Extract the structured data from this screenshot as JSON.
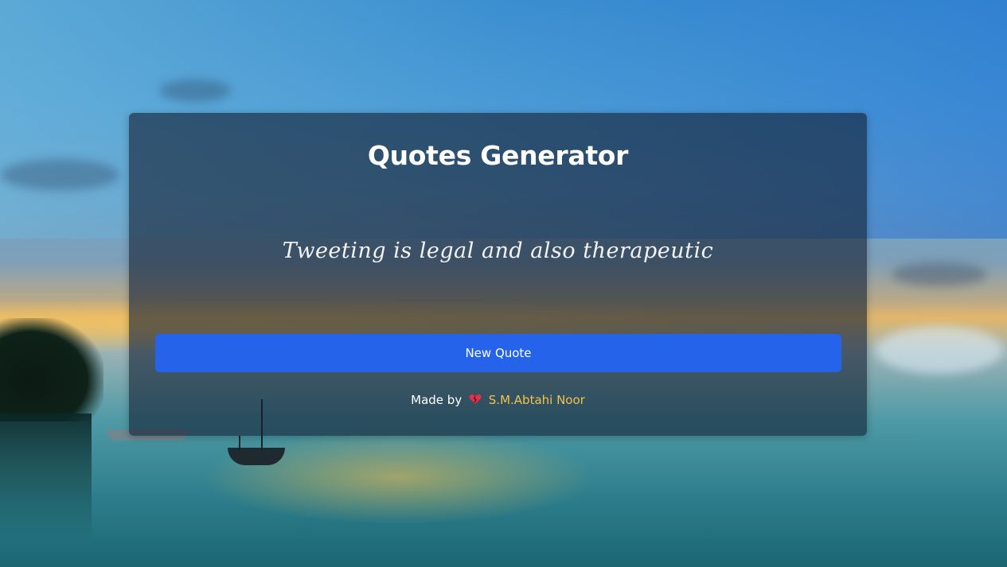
{
  "app": {
    "title": "Quotes Generator"
  },
  "quote": {
    "text": "Tweeting is legal and also therapeutic"
  },
  "actions": {
    "new_quote_label": "New Quote"
  },
  "footer": {
    "made_by_label": "Made by",
    "heart_icon": "broken-heart-icon",
    "author_name": "S.M.Abtahi Noor"
  },
  "colors": {
    "button": "#2563eb",
    "author_link": "#f2c14e",
    "card_background": "rgba(20, 32, 52, 0.62)"
  }
}
